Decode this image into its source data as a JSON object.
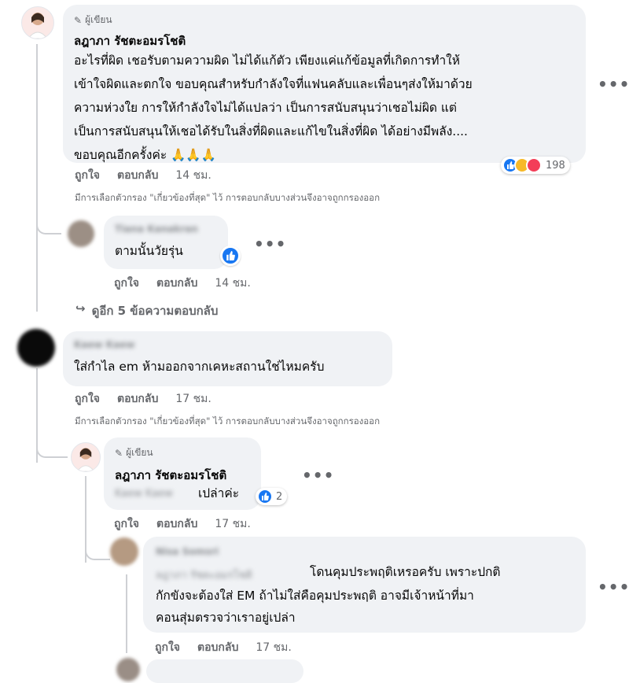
{
  "author_badge": "ผู้เขียน",
  "comment1": {
    "author": "ลฎาภา รัชตะอมรโชติ",
    "lines": [
      "อะไรที่ผิด เชอรับตามความผิด ไม่ได้แก้ตัว เพียงแค่แก้ข้อมูลที่เกิดการทำให้",
      "เข้าใจผิดและตกใจ ขอบคุณสำหรับกำลังใจที่แฟนคลับและเพื่อนๆส่งให้มาด้วย",
      "ความห่วงใย การให้กำลังใจไม่ได้แปลว่า เป็นการสนับสนุนว่าเชอไม่ผิด แต่",
      "เป็นการสนับสนุนให้เชอได้รับในสิ่งที่ผิดและแก้ไขในสิ่งที่ผิด ได้อย่างมีพลัง....",
      "ขอบคุณอีกครั้งค่ะ 🙏🙏🙏"
    ],
    "like": "ถูกใจ",
    "reply": "ตอบกลับ",
    "time": "14 ชม.",
    "reaction_count": "198",
    "filter_note": "มีการเลือกตัวกรอง \"เกี่ยวข้องที่สุด\" ไว้ การตอบกลับบางส่วนจึงอาจถูกกรองออก"
  },
  "reply1": {
    "author": "Tiana Kanakran",
    "text": "ตามนั้นวัยรุ่น",
    "like": "ถูกใจ",
    "reply": "ตอบกลับ",
    "time": "14 ชม."
  },
  "more_replies": "ดูอีก 5 ข้อความตอบกลับ",
  "comment2": {
    "author": "Kaew Kaew",
    "text": "ใส่กำไล em ห้ามออกจากเคหะสถานใช่ไหมครับ",
    "like": "ถูกใจ",
    "reply": "ตอบกลับ",
    "time": "17 ชม.",
    "filter_note": "มีการเลือกตัวกรอง \"เกี่ยวข้องที่สุด\" ไว้ การตอบกลับบางส่วนจึงอาจถูกกรองออก"
  },
  "reply2": {
    "author": "ลฎาภา รัชตะอมรโชติ",
    "mention": "Kaew Kaew",
    "text": "เปล่าค่ะ",
    "reaction_count": "2",
    "like": "ถูกใจ",
    "reply": "ตอบกลับ",
    "time": "17 ชม."
  },
  "reply3": {
    "author": "Nisa Somsri",
    "mention": "ลฎาภา รัชตะอมรโชติ",
    "line1": "โดนคุมประพฤติเหรอครับ เพราะปกติ",
    "line2": "กักขังจะต้องใส่ EM ถ้าไม่ใส่คือคุมประพฤติ อาจมีเจ้าหน้าที่มา",
    "line3": "คอนสุ่มตรวจว่าเราอยู่เปล่า",
    "like": "ถูกใจ",
    "reply": "ตอบกลับ",
    "time": "17 ชม."
  },
  "more_icon": "more-options-icon"
}
